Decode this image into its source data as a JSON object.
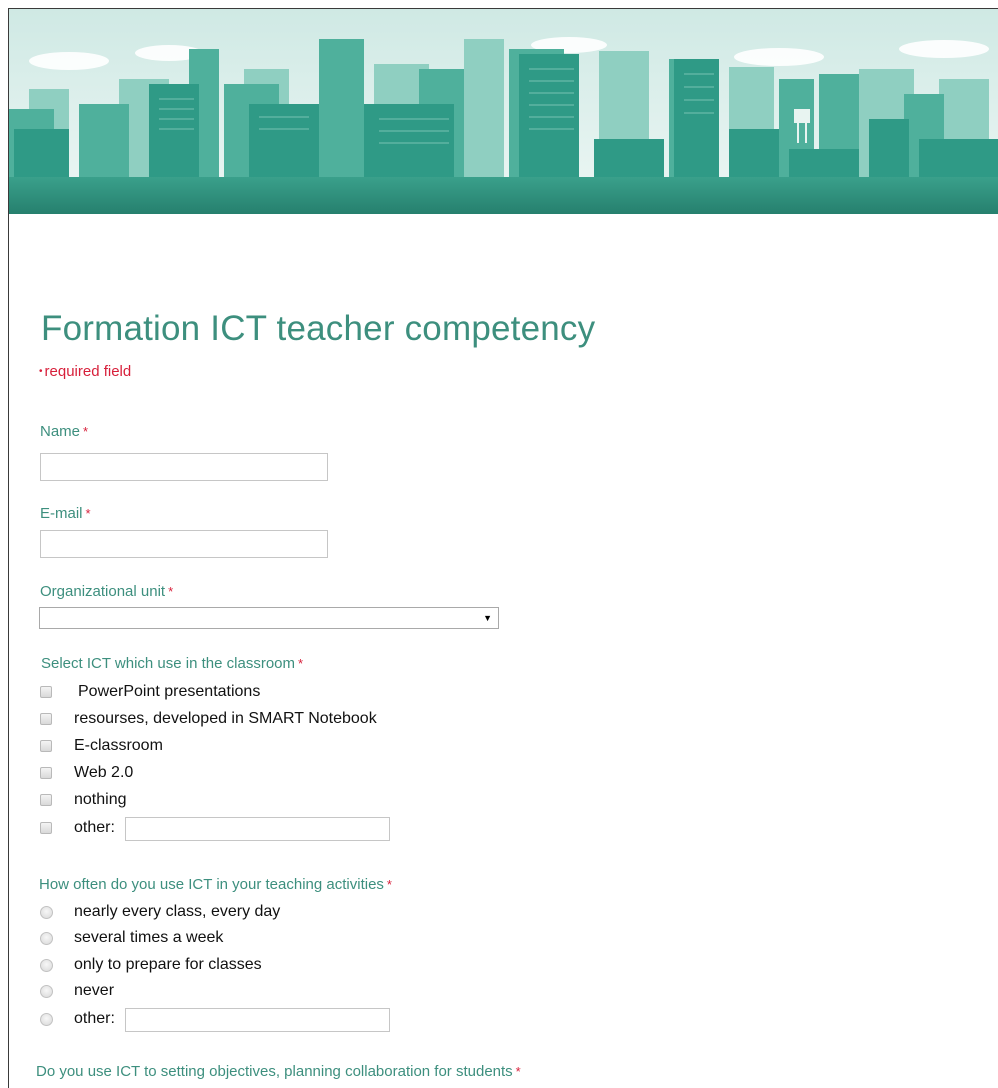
{
  "form": {
    "title": "Formation ICT teacher competency",
    "required_note": "required field",
    "required_dot": "•",
    "required_star": "*"
  },
  "fields": {
    "name": {
      "label": "Name",
      "value": ""
    },
    "email": {
      "label": "E-mail",
      "value": ""
    },
    "org_unit": {
      "label": "Organizational unit",
      "selected": "",
      "arrow": "▼"
    }
  },
  "ict_question": {
    "label": "Select ICT which use in the classroom",
    "options": [
      "PowerPoint presentations",
      "resourses, developed in SMART Notebook",
      "E-classroom",
      "Web 2.0",
      "nothing",
      "other:"
    ],
    "other_value": ""
  },
  "frequency_question": {
    "label": "How often do you use ICT in your teaching activities",
    "options": [
      "nearly every class, every day",
      "several times a week",
      "only to prepare for classes",
      "never",
      "other:"
    ],
    "other_value": ""
  },
  "objectives_question": {
    "label": "Do you use ICT to setting objectives, planning collaboration for students"
  },
  "colors": {
    "accent": "#3d8f7e",
    "required": "#d71f3a",
    "banner_sky": "#e4f2ef",
    "banner_buildings": "#2f9a86"
  }
}
